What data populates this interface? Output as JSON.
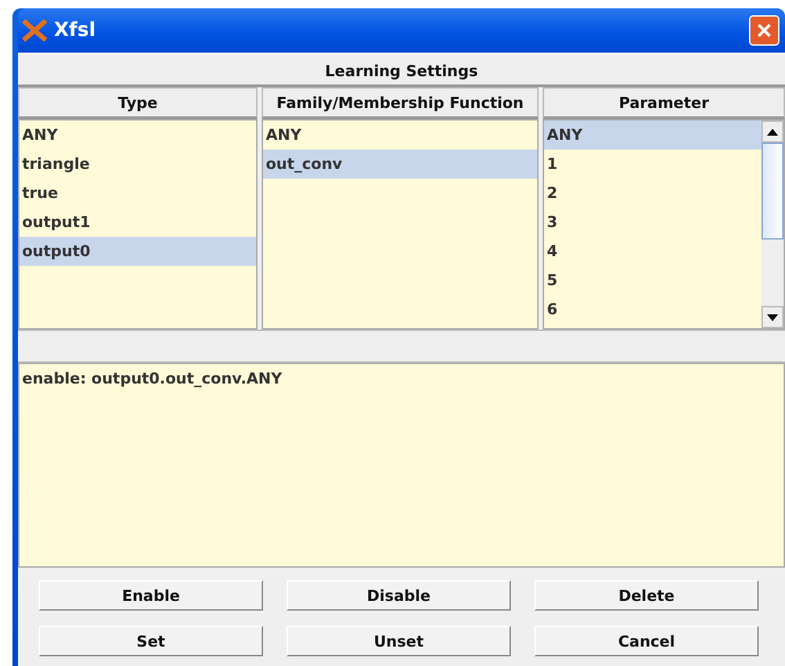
{
  "window": {
    "title": "Xfsl"
  },
  "section_title": "Learning Settings",
  "columns": [
    {
      "heading": "Type",
      "items": [
        {
          "label": "ANY",
          "selected": false
        },
        {
          "label": "triangle",
          "selected": false
        },
        {
          "label": "true",
          "selected": false
        },
        {
          "label": "output1",
          "selected": false
        },
        {
          "label": "output0",
          "selected": true
        }
      ]
    },
    {
      "heading": "Family/Membership Function",
      "items": [
        {
          "label": "ANY",
          "selected": false
        },
        {
          "label": "out_conv",
          "selected": true
        }
      ]
    },
    {
      "heading": "Parameter",
      "scrollable": true,
      "items": [
        {
          "label": "ANY",
          "selected": true
        },
        {
          "label": "1",
          "selected": false
        },
        {
          "label": "2",
          "selected": false
        },
        {
          "label": "3",
          "selected": false
        },
        {
          "label": "4",
          "selected": false
        },
        {
          "label": "5",
          "selected": false
        },
        {
          "label": "6",
          "selected": false
        }
      ]
    }
  ],
  "log": "enable: output0.out_conv.ANY",
  "buttons": [
    [
      "Enable",
      "Disable",
      "Delete"
    ],
    [
      "Set",
      "Unset",
      "Cancel"
    ]
  ]
}
